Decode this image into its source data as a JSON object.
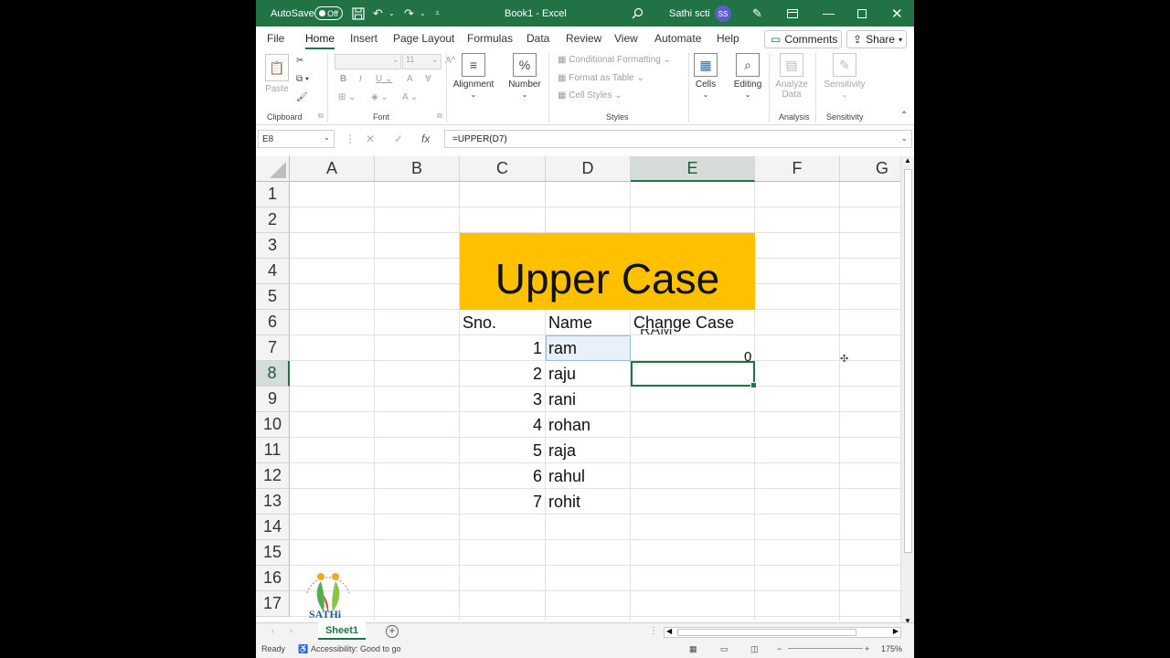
{
  "titlebar": {
    "autosave_label": "AutoSave",
    "autosave_state": "Off",
    "doc_title": "Book1  -  Excel",
    "user_name": "Sathi scti",
    "user_initials": "SS"
  },
  "tabs": [
    "File",
    "Home",
    "Insert",
    "Page Layout",
    "Formulas",
    "Data",
    "Review",
    "View",
    "Automate",
    "Help"
  ],
  "active_tab": "Home",
  "ribbon": {
    "comments": "Comments",
    "share": "Share",
    "paste": "Paste",
    "font_size": "11",
    "alignment": "Alignment",
    "number": "Number",
    "number_icon": "%",
    "conditional_formatting": "Conditional Formatting",
    "format_as_table": "Format as Table",
    "cell_styles": "Cell Styles",
    "cells": "Cells",
    "editing": "Editing",
    "analyze_data_1": "Analyze",
    "analyze_data_2": "Data",
    "sensitivity": "Sensitivity",
    "groups": {
      "clipboard": "Clipboard",
      "font": "Font",
      "styles": "Styles",
      "analysis": "Analysis",
      "sensitivity": "Sensitivity"
    }
  },
  "formula_bar": {
    "name_box": "E8",
    "formula": "=UPPER(D7)"
  },
  "grid": {
    "columns": [
      "A",
      "B",
      "C",
      "D",
      "E",
      "F",
      "G"
    ],
    "rows": [
      "1",
      "2",
      "3",
      "4",
      "5",
      "6",
      "7",
      "8",
      "9",
      "10",
      "11",
      "12",
      "13",
      "14",
      "15",
      "16",
      "17"
    ],
    "selected_column": "E",
    "selected_row": "8",
    "banner_title": "Upper Case",
    "headers": {
      "sno": "Sno.",
      "name": "Name",
      "change_case": "Change Case"
    },
    "data": [
      {
        "sno": "1",
        "name": "ram"
      },
      {
        "sno": "2",
        "name": "raju"
      },
      {
        "sno": "3",
        "name": "rani"
      },
      {
        "sno": "4",
        "name": "rohan"
      },
      {
        "sno": "5",
        "name": "raja"
      },
      {
        "sno": "6",
        "name": "rahul"
      },
      {
        "sno": "7",
        "name": "rohit"
      }
    ],
    "e7_value": "0",
    "e7_overflow": "RAM",
    "banner_color": "#ffc000"
  },
  "logo": {
    "name": "SATHi"
  },
  "sheets": {
    "active": "Sheet1"
  },
  "status": {
    "ready": "Ready",
    "accessibility": "Accessibility: Good to go",
    "zoom": "175%"
  },
  "colors": {
    "accent": "#217346"
  }
}
